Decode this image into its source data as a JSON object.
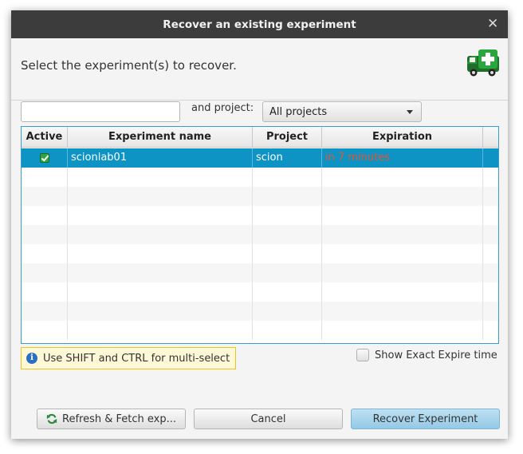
{
  "window": {
    "title": "Recover an existing experiment",
    "close_glyph": "✕"
  },
  "header": {
    "prompt": "Select the experiment(s) to recover.",
    "icon": "ambulance-icon"
  },
  "filter": {
    "search_value": "",
    "search_placeholder": "",
    "project_label": "and project:",
    "project_selected": "All projects"
  },
  "table": {
    "columns": [
      "Active",
      "Experiment name",
      "Project",
      "Expiration"
    ],
    "rows": [
      {
        "active": true,
        "name": "scionlab01",
        "project": "scion",
        "expiration": "in 7 minutes",
        "selected": true
      }
    ],
    "empty_rows": 9
  },
  "hint": {
    "icon": "info-icon",
    "text": "Use SHIFT and CTRL for multi-select"
  },
  "options": {
    "show_exact_expire_label": "Show Exact Expire time",
    "show_exact_expire_checked": false
  },
  "buttons": {
    "refresh_label": "Refresh & Fetch exp...",
    "cancel_label": "Cancel",
    "recover_label": "Recover Experiment"
  },
  "colors": {
    "titlebar": "#3c3c3c",
    "selection": "#0d93c4",
    "expiration_text": "#e8542a",
    "active_check": "#2aa63c",
    "hint_border": "#f0c419",
    "primary_button": "#93c9e6"
  }
}
